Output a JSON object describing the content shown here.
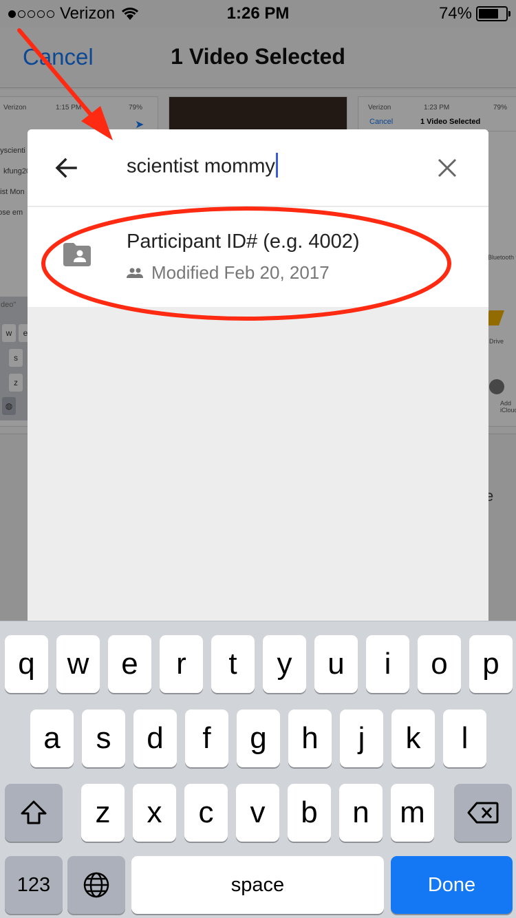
{
  "status_bar": {
    "carrier": "Verizon",
    "time": "1:26 PM",
    "battery": "74%",
    "battery_level": 0.74
  },
  "background": {
    "cancel_label": "Cancel",
    "title": "1 Video Selected",
    "left_thumb": {
      "carrier": "Verizon",
      "time": "1:15 PM",
      "battery": "79%",
      "lines": [
        "myscienti",
        "kfung20",
        "ntist Mon",
        "pose em"
      ],
      "field": "deo\"",
      "keys": [
        "w",
        "e",
        "s",
        "z"
      ]
    },
    "right_thumb": {
      "carrier": "Verizon",
      "time": "1:23 PM",
      "battery": "79%",
      "cancel_label": "Cancel",
      "title": "1 Video Selected",
      "snippet": "Bluetooth to",
      "drive_label": "Drive",
      "icloud_label": "Add iCloud"
    },
    "lower_fragment": "e"
  },
  "search": {
    "query": "scientist mommy",
    "placeholder": ""
  },
  "results": [
    {
      "title": "Participant ID# (e.g. 4002)",
      "meta": "Modified Feb 20, 2017",
      "icon": "shared-folder-icon"
    }
  ],
  "keyboard": {
    "row1": [
      "q",
      "w",
      "e",
      "r",
      "t",
      "y",
      "u",
      "i",
      "o",
      "p"
    ],
    "row2": [
      "a",
      "s",
      "d",
      "f",
      "g",
      "h",
      "j",
      "k",
      "l"
    ],
    "row3": [
      "z",
      "x",
      "c",
      "v",
      "b",
      "n",
      "m"
    ],
    "numbers_label": "123",
    "space_label": "space",
    "done_label": "Done"
  },
  "annotation_color": "#ff2a12",
  "accent_color": "#1478f5"
}
